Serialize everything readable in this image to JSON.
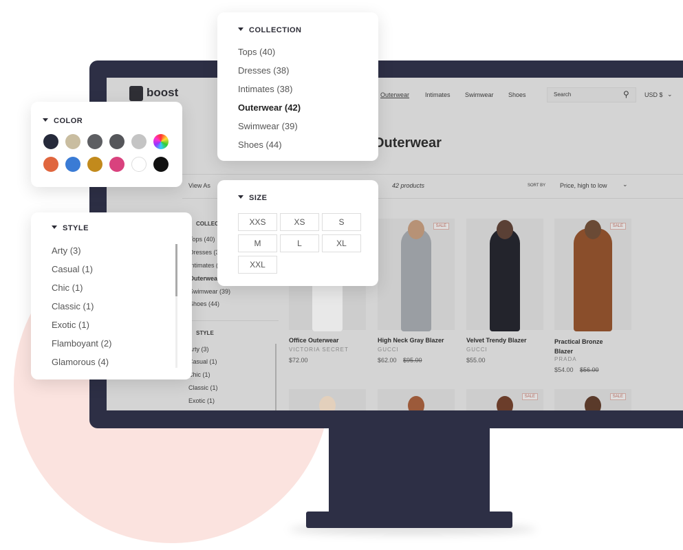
{
  "store": {
    "logo": "boost",
    "nav": [
      "Outerwear",
      "Intimates",
      "Swimwear",
      "Shoes"
    ],
    "search_placeholder": "Search",
    "currency": "USD $",
    "title": "Outerwear",
    "view_as": "View As",
    "count": "42 products",
    "sort_label": "SORT BY",
    "sort_value": "Price, high to low",
    "sidebar": {
      "collection_heading": "COLLECTION",
      "collection": [
        "Tops (40)",
        "Dresses (38)",
        "Intimates (38)",
        "Outerwear (42)",
        "Swimwear (39)",
        "Shoes (44)"
      ],
      "style_heading": "STYLE",
      "style": [
        "Arty (3)",
        "Casual (1)",
        "Chic (1)",
        "Classic (1)",
        "Exotic (1)"
      ]
    },
    "products": [
      {
        "name": "Office Outerwear",
        "brand": "VICTORIA SECRET",
        "price": "$72.00",
        "compare": "",
        "sale": false
      },
      {
        "name": "High Neck Gray Blazer",
        "brand": "GUCCI",
        "price": "$62.00",
        "compare": "$95.00",
        "sale": true,
        "badge": "SALE"
      },
      {
        "name": "Velvet Trendy Blazer",
        "brand": "GUCCI",
        "price": "$55.00",
        "compare": "",
        "sale": false
      },
      {
        "name": "Practical Bronze Blazer",
        "brand": "PRADA",
        "price": "$54.00",
        "compare": "$56.00",
        "sale": true,
        "badge": "SALE"
      }
    ],
    "row2_badges": [
      "SALE",
      "SALE"
    ]
  },
  "collection_panel": {
    "heading": "COLLECTION",
    "items": [
      "Tops (40)",
      "Dresses (38)",
      "Intimates (38)",
      "Outerwear (42)",
      "Swimwear (39)",
      "Shoes (44)"
    ],
    "selected": "Outerwear (42)"
  },
  "color_panel": {
    "heading": "COLOR",
    "swatches": [
      "#262a3b",
      "#c9bda0",
      "#5d5e62",
      "#55565a",
      "#c4c4c4",
      "multicolor",
      "#e0663e",
      "#3a7bd5",
      "#c28a1c",
      "#d9427e",
      "#ffffff",
      "#111111"
    ]
  },
  "size_panel": {
    "heading": "SIZE",
    "sizes": [
      "XXS",
      "XS",
      "S",
      "M",
      "L",
      "XL",
      "XXL"
    ]
  },
  "style_panel": {
    "heading": "STYLE",
    "items": [
      "Arty (3)",
      "Casual (1)",
      "Chic (1)",
      "Classic (1)",
      "Exotic (1)",
      "Flamboyant (2)",
      "Glamorous (4)"
    ]
  },
  "colors": {
    "frame": "#2d2f45",
    "accent_bg": "#fbe3df"
  }
}
